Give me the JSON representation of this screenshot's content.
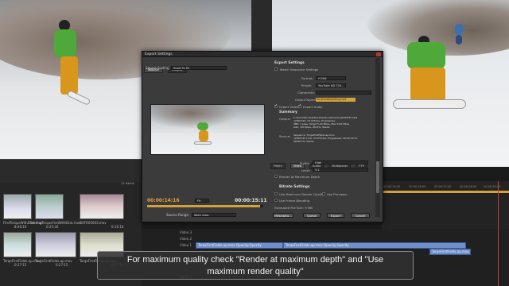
{
  "dialog": {
    "title": "Export Settings",
    "tabs": [
      "Source",
      "Output"
    ],
    "source_scaling_label": "Source Scaling:",
    "source_scaling_value": "Scale To Fit",
    "timecode_left": "00:00:14:16",
    "fit_value": "Fit",
    "timecode_right": "00:00:15:11",
    "source_range_label": "Source Range:",
    "source_range_value": "Work Area",
    "scrub_progress": 0.97
  },
  "export_settings": {
    "heading": "Export Settings",
    "match_sequence": "Match Sequence Settings",
    "format_label": "Format:",
    "format_value": "H.264",
    "preset_label": "Preset:",
    "preset_value": "YouTube HD 720...",
    "comments_label": "Comments:",
    "output_name_label": "Output Name:",
    "output_name_value": "TorqSnowboarding.mp4",
    "export_video": "Export Video",
    "export_audio": "Export Audio",
    "summary_heading": "Summary",
    "output_label": "Output:",
    "output_lines": [
      "C:\\Users\\Michael\\Desktop\\SnowboardingTestEdit.mp4",
      "1280x720, 23.976 fps, Progressive",
      "VBR, 1 pass, Target 5.00 Mbps, Max 5.00 Mbps",
      "AAC, 320 kbps, 48 kHz, Stereo"
    ],
    "source_label": "Source:",
    "source_lines": [
      "Sequence, TorqeFirstFields.ap.mov",
      "1280x720 (1.0), 23.976 fps, Progressive, 00:00:22:11",
      "48000 Hz, Stereo"
    ]
  },
  "sub_tabs": [
    "Filters",
    "Video",
    "Audio",
    "Multiplexer",
    "FTP"
  ],
  "video_settings": {
    "profile_label": "Profile:",
    "profile_value": "High",
    "level_label": "Level:",
    "level_value": "5.1",
    "render_max_depth": "Render at Maximum Depth",
    "bitrate_heading": "Bitrate Settings",
    "use_max_quality": "Use Maximum Render Quality",
    "use_previews": "Use Previews",
    "use_frame_blending": "Use Frame Blending",
    "est_file_size": "Estimated File Size: 9 MB"
  },
  "buttons": {
    "metadata": "Metadata...",
    "queue": "Queue",
    "export": "Export",
    "cancel": "Cancel"
  },
  "project": {
    "item_count": "11 Items",
    "clips": [
      {
        "name": "FirstTorqueWithDisk.mov",
        "dur": "8:46:10"
      },
      {
        "name": "SettingTorqueFirstWithDisk.mov",
        "dur": "0:25:20"
      },
      {
        "name": "DXFR00003.mov",
        "dur": "0:16:10"
      },
      {
        "name": "TorqeFirstFields.ap.mov",
        "dur": "0:27:15"
      },
      {
        "name": "TorqeFirstFields.ap.mov",
        "dur": "0:27:15"
      },
      {
        "name": "TorqeFirstFields.ap.mov",
        "dur": "0:27:15"
      }
    ]
  },
  "timeline": {
    "tracks": [
      "Video 3",
      "Video 2",
      "Video 1",
      "Audio 1"
    ],
    "ticks": [
      "00:00:14:00",
      "00:00:18:00",
      "00:00:22:00",
      "00:00:26:00",
      "00:00:30:00"
    ],
    "clip_labels": [
      "TorqeFirstFields.ap.mov Opacity:Opacity",
      "TorqeFirstFields.ap.mov Opacity:Opacity",
      "TorqeFirstFields.ap.mov [V]"
    ]
  },
  "caption": {
    "line1": "For maximum quality check \"Render at maximum depth\" and \"Use",
    "line2": "maximum render quality\""
  },
  "colors": {
    "accent": "#d4a23a",
    "jacket": "#4fa83a",
    "pants": "#d8961d"
  }
}
